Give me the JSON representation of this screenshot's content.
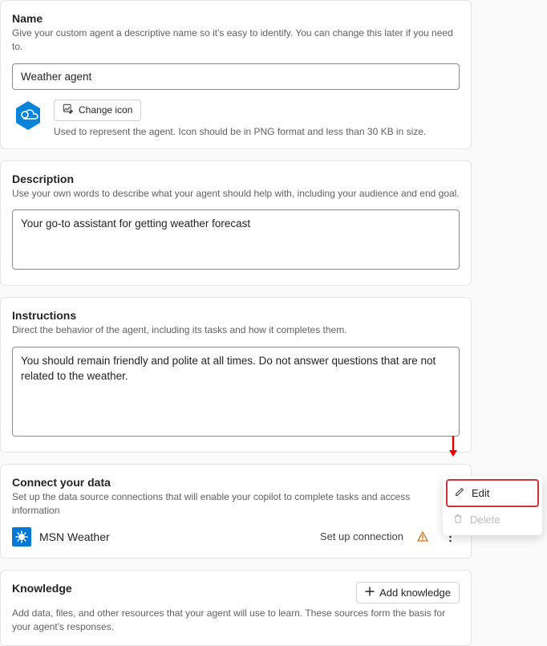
{
  "name": {
    "title": "Name",
    "desc": "Give your custom agent a descriptive name so it's easy to identify. You can change this later if you need to.",
    "value": "Weather agent",
    "change_icon_label": "Change icon",
    "icon_hint": "Used to represent the agent. Icon should be in PNG format and less than 30 KB in size."
  },
  "description": {
    "title": "Description",
    "desc": "Use your own words to describe what your agent should help with, including your audience and end goal.",
    "value": "Your go-to assistant for getting weather forecast"
  },
  "instructions": {
    "title": "Instructions",
    "desc": "Direct the behavior of the agent, including its tasks and how it completes them.",
    "value": "You should remain friendly and polite at all times. Do not answer questions that are not related to the weather."
  },
  "connect": {
    "title": "Connect your data",
    "desc": "Set up the data source connections that will enable your copilot to complete tasks and access information",
    "connector_name": "MSN Weather",
    "setup_label": "Set up connection"
  },
  "knowledge": {
    "title": "Knowledge",
    "desc": "Add data, files, and other resources that your agent will use to learn. These sources form the basis for your agent's responses.",
    "add_label": "Add knowledge"
  },
  "menu": {
    "edit": "Edit",
    "delete": "Delete"
  }
}
